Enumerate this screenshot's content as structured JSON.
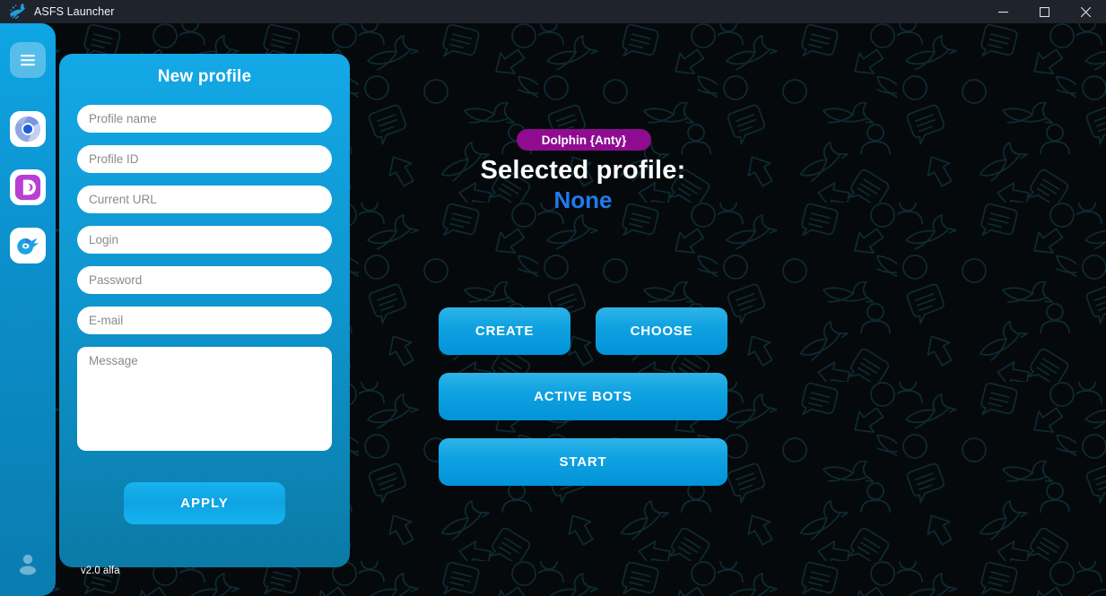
{
  "titlebar": {
    "title": "ASFS Launcher",
    "app_icon": "asfs-bird-logo-icon",
    "controls": {
      "minimize": "minimize-icon",
      "maximize": "maximize-icon",
      "close": "close-icon"
    }
  },
  "sidebar": {
    "items": [
      {
        "id": "menu",
        "icon": "hamburger-menu-icon",
        "label": "Menu"
      },
      {
        "id": "chromium",
        "icon": "chromium-browser-icon",
        "label": "Chromium"
      },
      {
        "id": "dolphin",
        "icon": "dolphin-anty-icon",
        "label": "Dolphin Anty"
      },
      {
        "id": "octo",
        "icon": "octo-browser-icon",
        "label": "Octo Browser"
      }
    ],
    "footer": {
      "id": "user",
      "icon": "user-profile-icon",
      "label": "User"
    }
  },
  "form": {
    "title": "New profile",
    "fields": [
      {
        "name": "profile-name",
        "placeholder": "Profile name",
        "value": ""
      },
      {
        "name": "profile-id",
        "placeholder": "Profile ID",
        "value": ""
      },
      {
        "name": "current-url",
        "placeholder": "Current URL",
        "value": ""
      },
      {
        "name": "login",
        "placeholder": "Login",
        "value": ""
      },
      {
        "name": "password",
        "placeholder": "Password",
        "value": ""
      },
      {
        "name": "email",
        "placeholder": "E-mail",
        "value": ""
      }
    ],
    "message": {
      "placeholder": "Message",
      "value": ""
    },
    "apply_label": "APPLY"
  },
  "version": "v2.0 alfa",
  "main": {
    "badge": "Dolphin {Anty}",
    "selected_profile_label": "Selected profile:",
    "selected_profile_value": "None",
    "buttons": {
      "create": "CREATE",
      "choose": "CHOOSE",
      "active_bots": "ACTIVE BOTS",
      "start": "START"
    }
  },
  "colors": {
    "accent_blue": "#0fa2e1",
    "panel_blue_top": "#13a8e6",
    "panel_blue_bottom": "#0b7aa6",
    "badge_purple": "#8f0c91",
    "selected_value_blue": "#1f7bf0",
    "titlebar_bg": "#1f232b",
    "background_dark": "#05090b",
    "pattern_stroke": "#0e2a33"
  }
}
